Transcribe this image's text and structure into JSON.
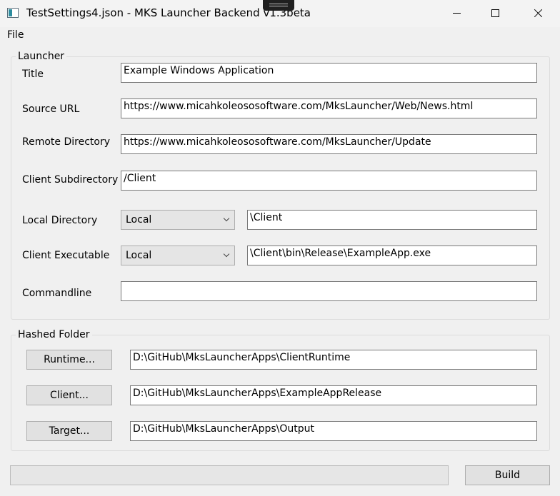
{
  "titlebar": {
    "title": "TestSettings4.json - MKS Launcher Backend v1.3beta"
  },
  "menu": {
    "file": "File"
  },
  "launcher": {
    "legend": "Launcher",
    "title_label": "Title",
    "title_value": "Example Windows Application",
    "source_url_label": "Source URL",
    "source_url_value": "https://www.micahkoleososoftware.com/MksLauncher/Web/News.html",
    "remote_dir_label": "Remote Directory",
    "remote_dir_value": "https://www.micahkoleososoftware.com/MksLauncher/Update",
    "client_subdir_label": "Client Subdirectory",
    "client_subdir_value": "/Client",
    "local_dir_label": "Local Directory",
    "local_dir_combo": "Local",
    "local_dir_value": "\\Client",
    "client_exe_label": "Client Executable",
    "client_exe_combo": "Local",
    "client_exe_value": "\\Client\\bin\\Release\\ExampleApp.exe",
    "commandline_label": "Commandline",
    "commandline_value": ""
  },
  "hashed": {
    "legend": "Hashed Folder",
    "runtime_button": "Runtime...",
    "runtime_value": "D:\\GitHub\\MksLauncherApps\\ClientRuntime",
    "client_button": "Client...",
    "client_value": "D:\\GitHub\\MksLauncherApps\\ExampleAppRelease",
    "target_button": "Target...",
    "target_value": "D:\\GitHub\\MksLauncherApps\\Output"
  },
  "footer": {
    "build_button": "Build",
    "progress": 0
  }
}
